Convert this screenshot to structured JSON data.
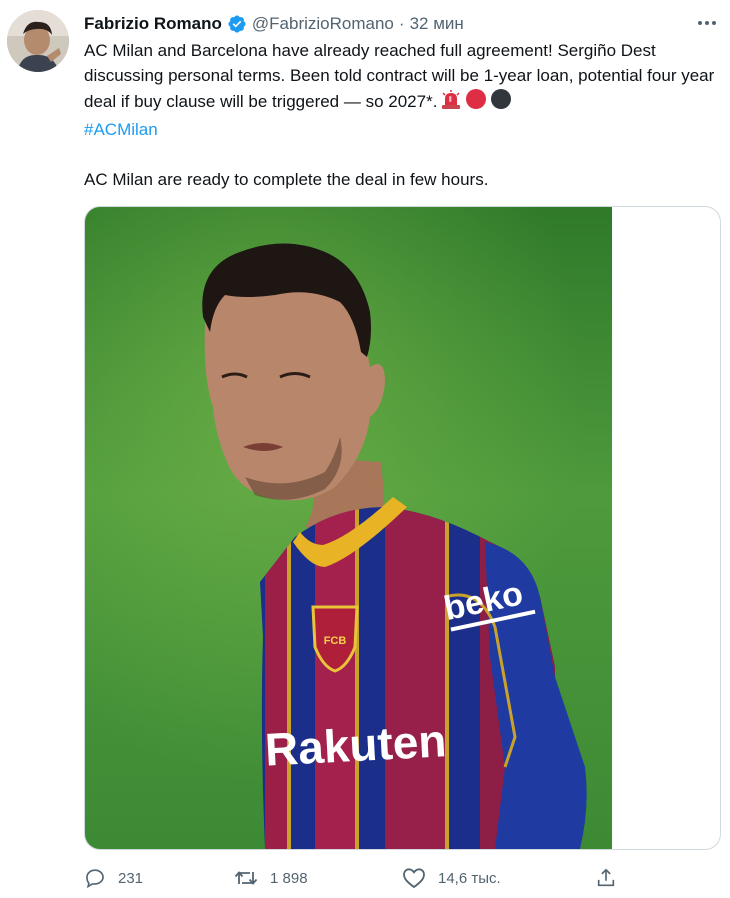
{
  "author": {
    "name": "Fabrizio Romano",
    "handle": "@FabrizioRomano",
    "separator": "·",
    "time": "32 мин",
    "verified_color": "#1d9bf0"
  },
  "tweet": {
    "paragraph_1": "AC Milan and Barcelona have already reached full agreement! Sergiño Dest discussing personal terms. Been told contract will be 1-year loan, potential four year deal if buy clause will be triggered — so 2027*.",
    "hashtag": "#ACMilan",
    "paragraph_2": "AC Milan are ready to complete the deal in few hours.",
    "emojis": [
      "siren-emoji",
      "red-circle-emoji",
      "black-circle-emoji"
    ]
  },
  "media": {
    "jersey_sponsor": "beko",
    "jersey_main_sponsor": "Rakuten",
    "crest_text": "FCB"
  },
  "actions": {
    "reply_count": "231",
    "retweet_count": "1 898",
    "like_count": "14,6 тыс."
  },
  "colors": {
    "hashtag": "#1d9bf0",
    "secondary_text": "#536471",
    "pitch_green": "#3e8f2f"
  }
}
